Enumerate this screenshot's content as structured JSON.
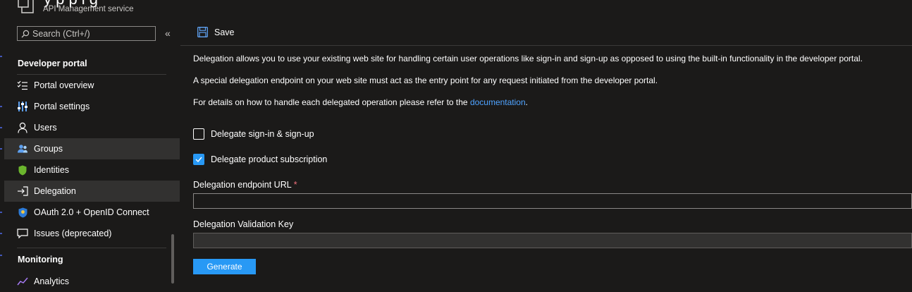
{
  "header": {
    "title": "y          p       p    l    g",
    "subtitle": "API Management service"
  },
  "sidebar": {
    "search_placeholder": "Search (Ctrl+/)",
    "collapse_glyph": "«",
    "section_developer_portal": "Developer portal",
    "section_monitoring": "Monitoring",
    "items": [
      {
        "label": "Portal overview",
        "icon": "list-checks-icon",
        "highlighted": false
      },
      {
        "label": "Portal settings",
        "icon": "sliders-icon",
        "highlighted": false
      },
      {
        "label": "Users",
        "icon": "user-icon",
        "highlighted": false
      },
      {
        "label": "Groups",
        "icon": "groups-icon",
        "highlighted": true
      },
      {
        "label": "Identities",
        "icon": "shield-icon",
        "highlighted": false
      },
      {
        "label": "Delegation",
        "icon": "sign-in-icon",
        "highlighted": true
      },
      {
        "label": "OAuth 2.0 + OpenID Connect",
        "icon": "oauth-shield-icon",
        "highlighted": false
      },
      {
        "label": "Issues (deprecated)",
        "icon": "chat-icon",
        "highlighted": false
      },
      {
        "label": "Analytics",
        "icon": "analytics-icon",
        "highlighted": false
      }
    ]
  },
  "toolbar": {
    "save_label": "Save"
  },
  "content": {
    "para1": "Delegation allows you to use your existing web site for handling certain user operations like sign-in and sign-up as opposed to using the built-in functionality in the developer portal.",
    "para2": "A special delegation endpoint on your web site must act as the entry point for any request initiated from the developer portal.",
    "para3_prefix": "For details on how to handle each delegated operation please refer to the ",
    "para3_link": "documentation",
    "para3_suffix": ".",
    "checkbox_signin": {
      "label": "Delegate sign-in & sign-up",
      "checked": false
    },
    "checkbox_subscription": {
      "label": "Delegate product subscription",
      "checked": true
    },
    "endpoint_label": "Delegation endpoint URL",
    "required_mark": "*",
    "endpoint_value": "",
    "key_label": "Delegation Validation Key",
    "key_value": "",
    "generate_label": "Generate"
  },
  "colors": {
    "accent": "#2899f5",
    "link": "#4fa3ff",
    "required": "#f1707b",
    "background": "#1b1a19",
    "highlight": "#323130"
  }
}
